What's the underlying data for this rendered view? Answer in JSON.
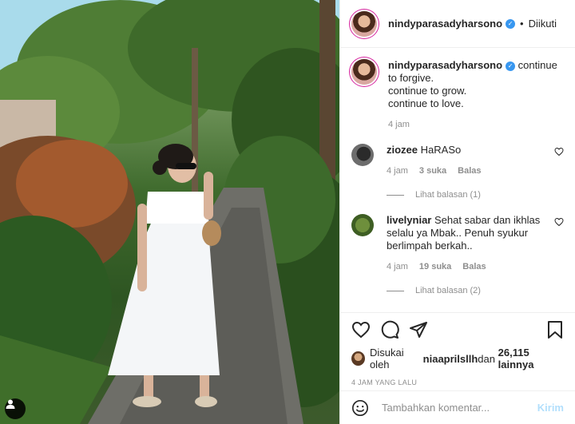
{
  "post": {
    "user_tag_icon": "person-icon"
  },
  "header": {
    "username": "nindyparasadyharsono",
    "verified_icon": "verified-badge-icon",
    "dot": "•",
    "follow_label": "Diikuti"
  },
  "caption": {
    "username": "nindyparasadyharsono",
    "text": "continue to forgive.\ncontinue to grow.\ncontinue to love.",
    "time": "4 jam"
  },
  "comments": [
    {
      "username": "ziozee",
      "text": "HaRASo",
      "time": "4 jam",
      "likes": "3 suka",
      "reply_label": "Balas",
      "view_replies": "Lihat balasan (1)"
    },
    {
      "username": "livelyniar",
      "text": "Sehat sabar dan ikhlas selalu ya Mbak.. Penuh syukur berlimpah berkah..",
      "time": "4 jam",
      "likes": "19 suka",
      "reply_label": "Balas",
      "view_replies": "Lihat balasan (2)"
    }
  ],
  "actions": {
    "liked_by_prefix": "Disukai oleh ",
    "liked_by_user": "niaaprilsllh",
    "liked_by_mid": " dan ",
    "liked_by_count": "26,115 lainnya",
    "timestamp": "4 JAM YANG LALU"
  },
  "comment_box": {
    "placeholder": "Tambahkan komentar...",
    "post_label": "Kirim"
  },
  "colors": {
    "link": "#3897f0",
    "muted": "#8e8e8e",
    "post_disabled": "#b2dffc"
  }
}
